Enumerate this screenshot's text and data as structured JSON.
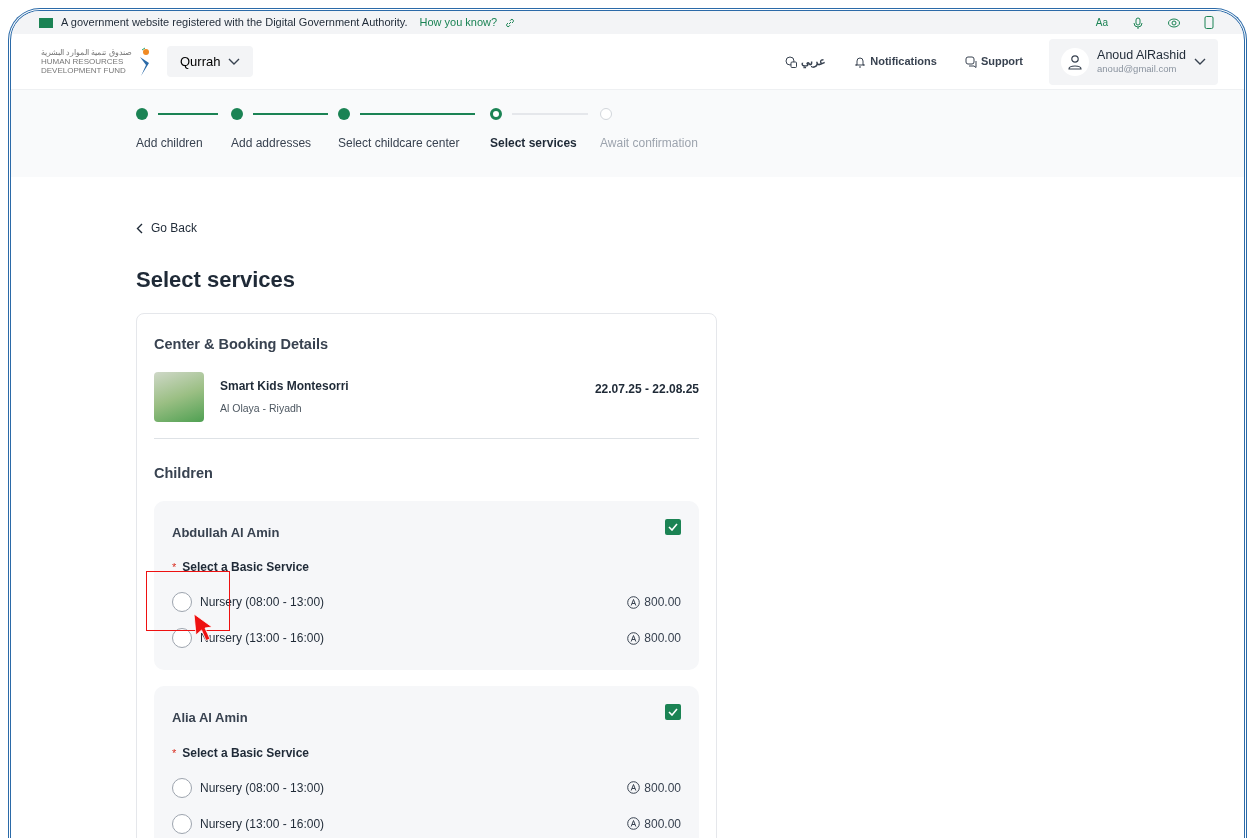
{
  "gov_banner": {
    "text": "A government website registered with the Digital Government Authority.",
    "link": "How you know?",
    "text_size_label": "Aa"
  },
  "header": {
    "logo": {
      "arabic": "صندوق تنمية الموارد البشرية",
      "english": "HUMAN RESOURCES DEVELOPMENT FUND"
    },
    "app_switcher": "Qurrah",
    "language": "عربي",
    "notifications": "Notifications",
    "support": "Support",
    "user": {
      "name": "Anoud AlRashid",
      "email": "anoud@gmail.com"
    }
  },
  "steps": [
    {
      "label": "Add children",
      "done": true,
      "selected": false
    },
    {
      "label": "Add addresses",
      "done": true,
      "selected": false
    },
    {
      "label": "Select childcare center",
      "done": true,
      "selected": false
    },
    {
      "label": "Select services",
      "done": false,
      "selected": true
    },
    {
      "label": "Await confirmation",
      "done": false,
      "selected": false
    }
  ],
  "back_link": "Go Back",
  "page_title": "Select services",
  "booking": {
    "title": "Center & Booking Details",
    "center_name": "Smart Kids Montesorri",
    "location": "Al Olaya - Riyadh",
    "dates": "22.07.25 - 22.08.25"
  },
  "children_title": "Children",
  "children": [
    {
      "name": "Abdullah Al Amin",
      "checked": true,
      "service_label": "Select a Basic Service",
      "required_mark": "*",
      "highlighted": true,
      "options": [
        {
          "label": "Nursery (08:00 - 13:00)",
          "price": "800.00",
          "selected": false
        },
        {
          "label": "Nursery (13:00 - 16:00)",
          "price": "800.00",
          "selected": false
        }
      ]
    },
    {
      "name": "Alia Al Amin",
      "checked": true,
      "service_label": "Select a Basic Service",
      "required_mark": "*",
      "highlighted": false,
      "options": [
        {
          "label": "Nursery (08:00 - 13:00)",
          "price": "800.00",
          "selected": false
        },
        {
          "label": "Nursery (13:00 - 16:00)",
          "price": "800.00",
          "selected": false
        }
      ]
    }
  ]
}
